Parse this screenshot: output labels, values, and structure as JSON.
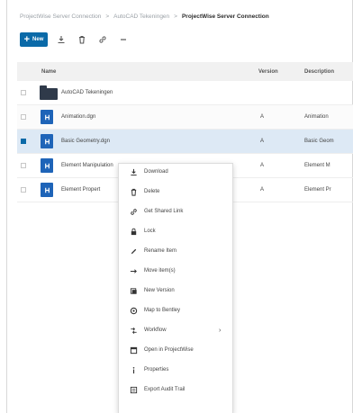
{
  "breadcrumb": {
    "items": [
      "ProjectWise Server Connection",
      "AutoCAD Tekeningen"
    ],
    "current": "ProjectWise Server Connection",
    "separator": ">"
  },
  "toolbar": {
    "new_label": "New",
    "icons": [
      "download-icon",
      "delete-icon",
      "link-icon",
      "more-icon"
    ]
  },
  "table": {
    "columns": {
      "name": "Name",
      "version": "Version",
      "description": "Description"
    },
    "rows": [
      {
        "type": "folder",
        "name": "AutoCAD Tekeningen",
        "version": "",
        "description": ""
      },
      {
        "type": "file",
        "name": "Animation.dgn",
        "version": "A",
        "description": "Animation"
      },
      {
        "type": "file",
        "name": "Basic Geometry.dgn",
        "version": "A",
        "description": "Basic Geom"
      },
      {
        "type": "file",
        "name": "Element Manipulation",
        "version": "A",
        "description": "Element M"
      },
      {
        "type": "file",
        "name": "Element Propert",
        "version": "A",
        "description": "Element Pr"
      }
    ]
  },
  "context_menu": {
    "items": [
      {
        "label": "Download",
        "icon": "download-icon"
      },
      {
        "label": "Delete",
        "icon": "trash-icon"
      },
      {
        "label": "Get Shared Link",
        "icon": "link-icon"
      },
      {
        "label": "Lock",
        "icon": "lock-icon"
      },
      {
        "label": "Rename Item",
        "icon": "pencil-icon"
      },
      {
        "label": "Move item(s)",
        "icon": "arrow-right-icon"
      },
      {
        "label": "New Version",
        "icon": "version-icon"
      },
      {
        "label": "Map to Bentley",
        "icon": "map-icon"
      },
      {
        "label": "Workflow",
        "icon": "workflow-icon",
        "submenu": true
      },
      {
        "label": "Open in ProjectWise",
        "icon": "open-window-icon"
      },
      {
        "label": "Properties",
        "icon": "info-icon"
      },
      {
        "label": "Export Audit Trail",
        "icon": "export-icon"
      }
    ]
  },
  "colors": {
    "accent": "#0b6aa8",
    "file_icon": "#1e64b8",
    "folder_icon": "#2f3a4a",
    "selected_row": "#dde9f5",
    "header_bg": "#f1f1f1"
  }
}
